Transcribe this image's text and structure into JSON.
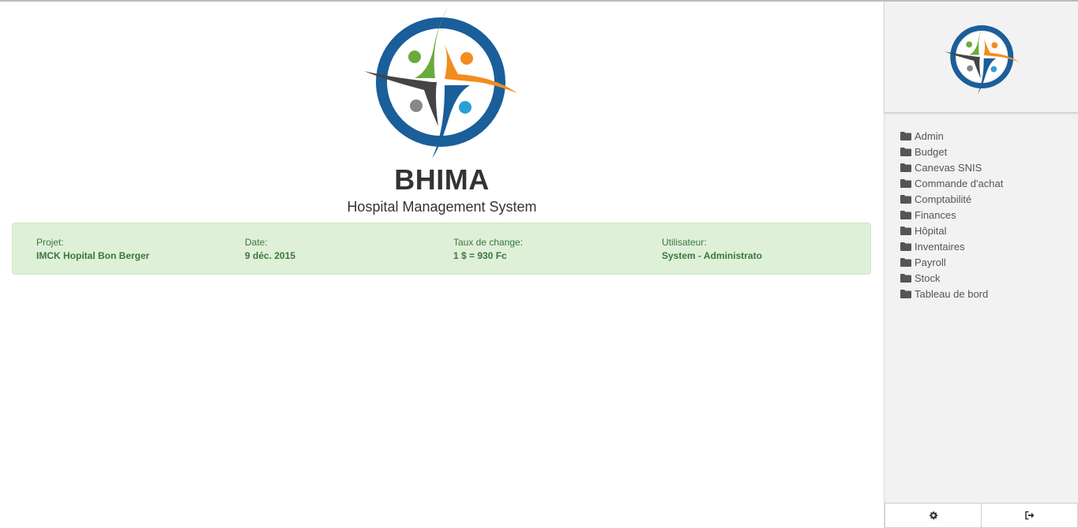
{
  "app": {
    "title": "BHIMA",
    "subtitle": "Hospital Management System"
  },
  "info": [
    {
      "label": "Projet:",
      "value": "IMCK Hopital Bon Berger"
    },
    {
      "label": "Date:",
      "value": "9 déc. 2015"
    },
    {
      "label": "Taux de change:",
      "value": "1 $ = 930 Fc"
    },
    {
      "label": "Utilisateur:",
      "value": "System - Administrato"
    }
  ],
  "sidebar": {
    "menu": [
      {
        "label": "Admin",
        "icon": "folder-icon"
      },
      {
        "label": "Budget",
        "icon": "folder-icon"
      },
      {
        "label": "Canevas SNIS",
        "icon": "folder-icon"
      },
      {
        "label": "Commande d'achat",
        "icon": "folder-icon"
      },
      {
        "label": "Comptabilité",
        "icon": "folder-icon"
      },
      {
        "label": "Finances",
        "icon": "folder-icon"
      },
      {
        "label": "Hôpital",
        "icon": "folder-icon"
      },
      {
        "label": "Inventaires",
        "icon": "folder-icon"
      },
      {
        "label": "Payroll",
        "icon": "folder-icon"
      },
      {
        "label": "Stock",
        "icon": "folder-icon"
      },
      {
        "label": "Tableau de bord",
        "icon": "folder-icon"
      }
    ],
    "bottom_buttons": [
      {
        "icon": "gear-icon"
      },
      {
        "icon": "sign-out-icon"
      }
    ]
  },
  "colors": {
    "info_bg": "#dff0d8",
    "info_text": "#3c763d",
    "sidebar_bg": "#f2f2f2",
    "logo_blue": "#1a5e9a",
    "logo_green": "#6aab3b",
    "logo_orange": "#f28c1d",
    "logo_dark": "#444444",
    "logo_cyan": "#2aa0d8"
  }
}
